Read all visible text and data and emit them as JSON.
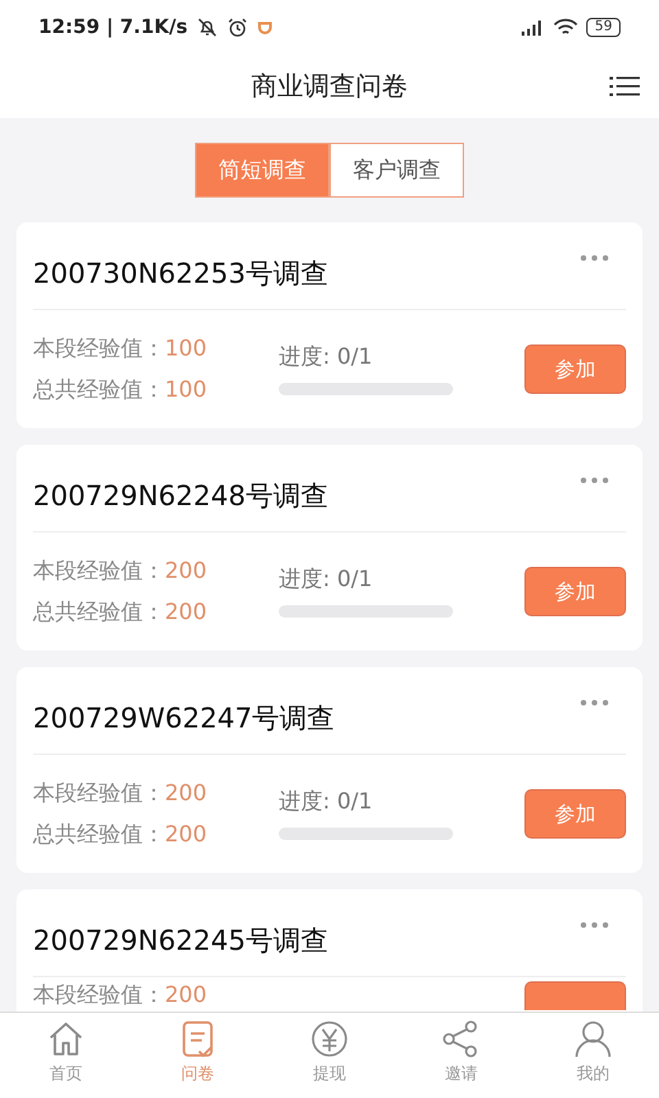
{
  "status_bar": {
    "time": "12:59 | 7.1K/s",
    "battery": "59"
  },
  "header": {
    "title": "商业调查问卷"
  },
  "segments": [
    {
      "label": "简短调查",
      "selected": true
    },
    {
      "label": "客户调查",
      "selected": false
    }
  ],
  "cards": [
    {
      "title": "200730N62253号调查",
      "stats": [
        {
          "label": "本段经验值：",
          "value": "100"
        },
        {
          "label": "总共经验值：",
          "value": "100"
        }
      ],
      "progress": {
        "text": "进度: 0/1",
        "level": 0
      },
      "button": "参加"
    },
    {
      "title": "200729N62248号调查",
      "stats": [
        {
          "label": "本段经验值：",
          "value": "200"
        },
        {
          "label": "总共经验值：",
          "value": "200"
        }
      ],
      "progress": {
        "text": "进度: 0/1",
        "level": 0
      },
      "button": "参加"
    },
    {
      "title": "200729W62247号调查",
      "stats": [
        {
          "label": "本段经验值：",
          "value": "200"
        },
        {
          "label": "总共经验值：",
          "value": "200"
        }
      ],
      "progress": {
        "text": "进度: 0/1",
        "level": 0
      },
      "button": "参加"
    },
    {
      "title": "200729N62245号调查",
      "stats": [
        {
          "label": "本段经验值：",
          "value": "200"
        }
      ]
    }
  ],
  "tab_bar": [
    {
      "label": "首页",
      "kind": "home",
      "selected": false
    },
    {
      "label": "问卷",
      "kind": "survey",
      "selected": true
    },
    {
      "label": "提现",
      "kind": "money",
      "selected": false
    },
    {
      "label": "邀请",
      "kind": "share",
      "selected": false
    },
    {
      "label": "我的",
      "kind": "person",
      "selected": false
    }
  ]
}
